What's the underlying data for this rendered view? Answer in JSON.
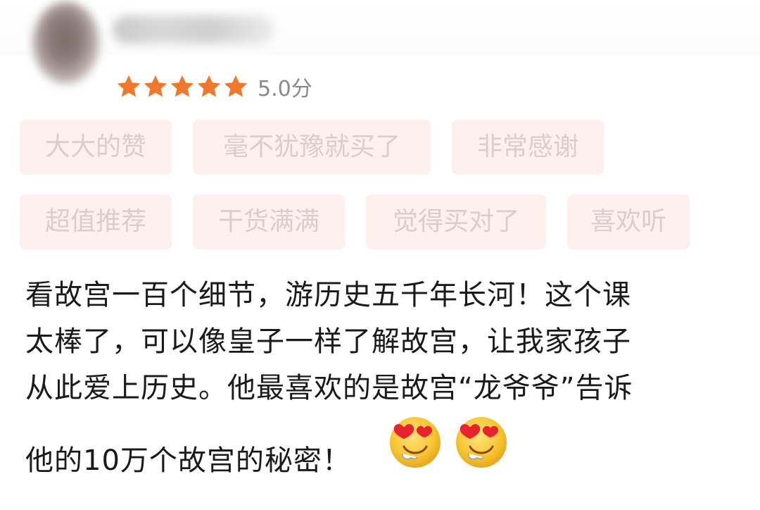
{
  "review_card": {
    "rating": {
      "stars_filled": 5,
      "stars_total": 5,
      "score_text": "5.0分"
    },
    "tags": {
      "row1": [
        "大大的赞",
        "毫不犹豫就买了",
        "非常感谢"
      ],
      "row2": [
        "超值推荐",
        "干货满满",
        "觉得买对了",
        "喜欢听"
      ]
    },
    "review_text": {
      "line1": "看故宫一百个细节，游历史五千年长河！这个课",
      "line2": "太棒了，可以像皇子一样了解故宫，让我家孩子",
      "line3": "从此爱上历史。他最喜欢的是故宫“龙爷爷”告诉",
      "line4": "他的10万个故宫的秘密！"
    },
    "emojis": [
      "heart-eyes-emoji",
      "heart-eyes-emoji"
    ]
  },
  "colors": {
    "star": "#f0782a",
    "tag_bg": "#fdf0ef",
    "tag_text": "#d9cdcd",
    "score_text": "#8a8a8a"
  }
}
